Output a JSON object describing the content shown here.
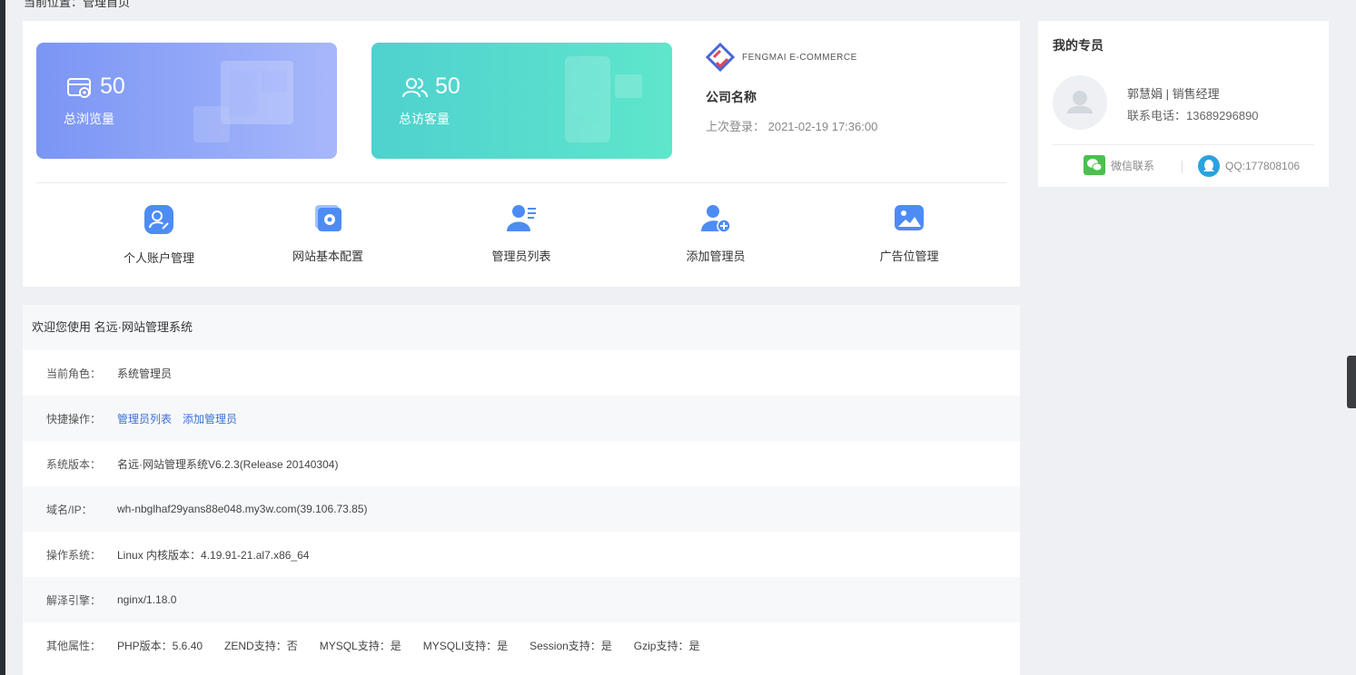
{
  "breadcrumb": "当前位置：管理首页",
  "stats": [
    {
      "value": "50",
      "label": "总浏览量",
      "icon": "browse-icon"
    },
    {
      "value": "50",
      "label": "总访客量",
      "icon": "visitors-icon"
    }
  ],
  "company": {
    "logo_text": "FENGMAI E-COMMERCE",
    "name": "公司名称",
    "last_login": "上次登录： 2021-02-19 17:36:00"
  },
  "quick_links": [
    {
      "label": "个人账户管理",
      "icon": "account-icon"
    },
    {
      "label": "网站基本配置",
      "icon": "settings-icon"
    },
    {
      "label": "管理员列表",
      "icon": "admin-list-icon"
    },
    {
      "label": "添加管理员",
      "icon": "add-admin-icon"
    },
    {
      "label": "广告位管理",
      "icon": "image-icon"
    }
  ],
  "info": {
    "header": "欢迎您使用 名远·网站管理系统",
    "rows": [
      {
        "key": "当前角色：",
        "values": [
          "系统管理员"
        ]
      },
      {
        "key": "快捷操作：",
        "links": [
          "管理员列表",
          "添加管理员"
        ]
      },
      {
        "key": "系统版本：",
        "values": [
          "名远·网站管理系统V6.2.3(Release 20140304)"
        ]
      },
      {
        "key": "域名/IP：",
        "values": [
          "wh-nbglhaf29yans88e048.my3w.com(39.106.73.85)"
        ]
      },
      {
        "key": "操作系统：",
        "values": [
          "Linux 内核版本：4.19.91-21.al7.x86_64"
        ]
      },
      {
        "key": "解泽引擎：",
        "values": [
          "nginx/1.18.0"
        ]
      },
      {
        "key": "其他属性：",
        "values": [
          "PHP版本：5.6.40",
          "ZEND支持：否",
          "MYSQL支持：是",
          "MYSQLI支持：是",
          "Session支持：是",
          "Gzip支持：是"
        ]
      }
    ]
  },
  "sidebar": {
    "title": "我的专员",
    "name": "郭慧娟 | 销售经理",
    "phone": "联系电话：13689296890",
    "wechat": "微信联系",
    "qq": "QQ:177808106"
  },
  "colors": {
    "accent": "#3b6fd8",
    "blue_card": "#7a95f4",
    "teal_card": "#4fd1cf",
    "wechat": "#4cbf4f",
    "qq": "#2ba2e0"
  }
}
